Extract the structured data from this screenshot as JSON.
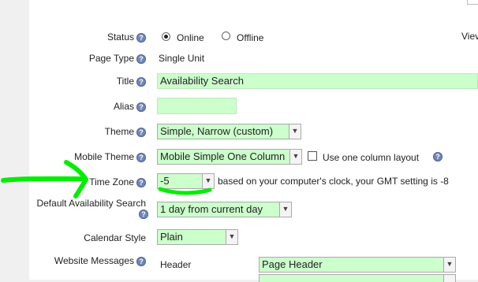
{
  "cutoff_right": "Viev",
  "fields": {
    "status": {
      "label": "Status",
      "options": [
        "Online",
        "Offline"
      ],
      "selected": "Online"
    },
    "page_type": {
      "label": "Page Type",
      "value": "Single Unit"
    },
    "title": {
      "label": "Title",
      "value": "Availability Search"
    },
    "alias": {
      "label": "Alias",
      "value": ""
    },
    "theme": {
      "label": "Theme",
      "value": "Simple, Narrow (custom)"
    },
    "mobile_theme": {
      "label": "Mobile Theme",
      "value": "Mobile Simple One Column",
      "checkbox_label": "Use one column layout"
    },
    "time_zone": {
      "label": "Time Zone",
      "value": "-5",
      "note": "based on your computer's clock, your GMT setting is -8"
    },
    "default_availability": {
      "label": "Default Availability Search",
      "value": "1 day from current day"
    },
    "calendar_style": {
      "label": "Calendar Style",
      "value": "Plain"
    },
    "website_messages": {
      "label": "Website Messages",
      "sub_label": "Header",
      "value": "Page Header"
    }
  },
  "help_glyph": "?",
  "colors": {
    "field_bg": "#ccffcc",
    "annotation": "#00ee00"
  }
}
